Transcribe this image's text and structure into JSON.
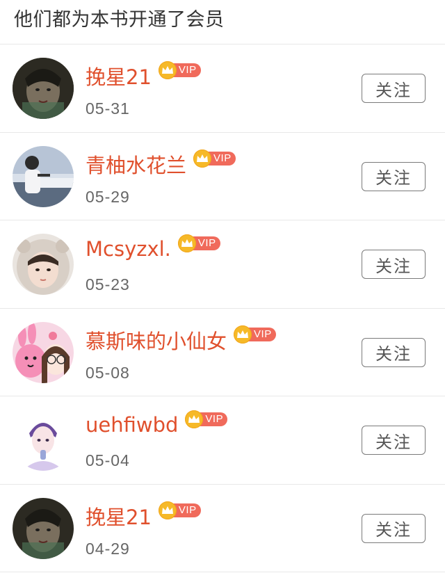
{
  "header": {
    "title": "他们都为本书开通了会员"
  },
  "vip_label": "VIP",
  "colors": {
    "name": "#e0502d",
    "vip_badge": "#f06a5b",
    "crown": "#f6b928",
    "divider": "#e8e8e8"
  },
  "members": [
    {
      "name": "挽星21",
      "date": "05-31",
      "follow_label": "关注",
      "avatar": "avatar-dark-portrait"
    },
    {
      "name": "青柚水花兰",
      "date": "05-29",
      "follow_label": "关注",
      "avatar": "avatar-piano-performer"
    },
    {
      "name": "Mcsyzxl.",
      "date": "05-23",
      "follow_label": "关注",
      "avatar": "avatar-bear-hood"
    },
    {
      "name": "慕斯味的小仙女",
      "date": "05-08",
      "follow_label": "关注",
      "avatar": "avatar-pink-cartoon"
    },
    {
      "name": "uehfiwbd",
      "date": "05-04",
      "follow_label": "关注",
      "avatar": "avatar-anime-boy"
    },
    {
      "name": "挽星21",
      "date": "04-29",
      "follow_label": "关注",
      "avatar": "avatar-dark-portrait"
    }
  ]
}
